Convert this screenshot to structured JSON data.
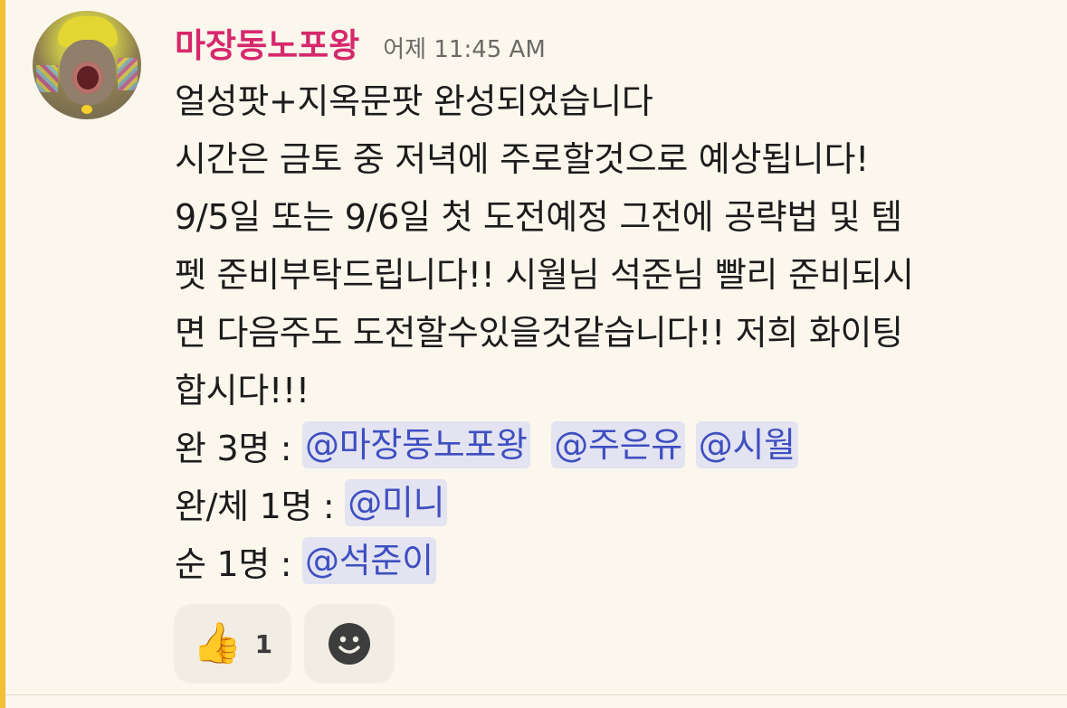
{
  "message": {
    "author": "마장동노포왕",
    "timestamp": "어제 11:45 AM",
    "lines": [
      "얼성팟+지옥문팟 완성되었습니다",
      "시간은 금토 중 저녁에 주로할것으로 예상됩니다!",
      "9/5일 또는 9/6일 첫 도전예정 그전에 공략법 및 템",
      "펫 준비부탁드립니다!! 시월님 석준님 빨리 준비되시",
      "면 다음주도 도전할수있을것같습니다!! 저희 화이팅",
      "합시다!!!"
    ],
    "roster": [
      {
        "prefix": "완 3명 : ",
        "mentions": [
          "@마장동노포왕",
          "@주은유",
          "@시월"
        ]
      },
      {
        "prefix": "완/체 1명 : ",
        "mentions": [
          "@미니"
        ]
      },
      {
        "prefix": "순 1명 : ",
        "mentions": [
          "@석준이"
        ]
      }
    ]
  },
  "reactions": [
    {
      "icon": "thumbs-up-icon",
      "emoji": "👍",
      "count": "1"
    }
  ],
  "add_reaction": {
    "icon": "smiley-icon"
  },
  "colors": {
    "background": "#fbf7ed",
    "accent_bar": "#f2bf35",
    "author": "#d6286c",
    "mention_text": "#3e4fc0",
    "mention_bg": "#e3e3f2"
  }
}
